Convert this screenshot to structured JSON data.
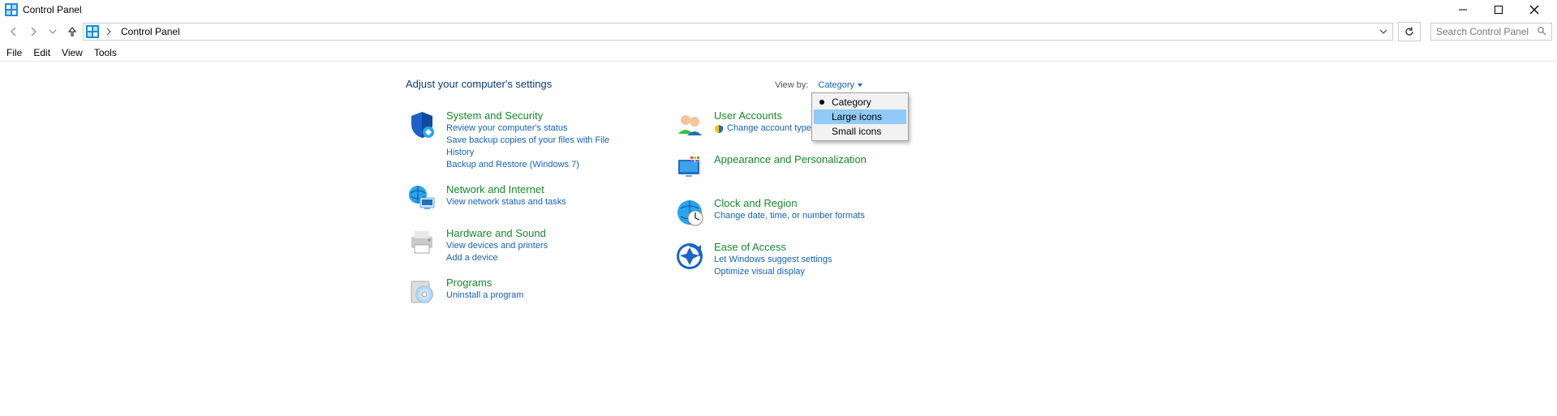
{
  "window": {
    "title": "Control Panel"
  },
  "address": {
    "crumb": "Control Panel"
  },
  "search": {
    "placeholder": "Search Control Panel"
  },
  "menu": [
    "File",
    "Edit",
    "View",
    "Tools"
  ],
  "header": {
    "heading": "Adjust your computer's settings",
    "viewby_label": "View by:",
    "viewby_value": "Category"
  },
  "viewby_options": [
    {
      "label": "Category",
      "selected": true,
      "hover": false
    },
    {
      "label": "Large icons",
      "selected": false,
      "hover": true
    },
    {
      "label": "Small icons",
      "selected": false,
      "hover": false
    }
  ],
  "left": [
    {
      "title": "System and Security",
      "links": [
        "Review your computer's status",
        "Save backup copies of your files with File History",
        "Backup and Restore (Windows 7)"
      ]
    },
    {
      "title": "Network and Internet",
      "links": [
        "View network status and tasks"
      ]
    },
    {
      "title": "Hardware and Sound",
      "links": [
        "View devices and printers",
        "Add a device"
      ]
    },
    {
      "title": "Programs",
      "links": [
        "Uninstall a program"
      ]
    }
  ],
  "right": [
    {
      "title": "User Accounts",
      "links": [
        "Change account type"
      ],
      "shield_on_link": true
    },
    {
      "title": "Appearance and Personalization",
      "links": []
    },
    {
      "title": "Clock and Region",
      "links": [
        "Change date, time, or number formats"
      ]
    },
    {
      "title": "Ease of Access",
      "links": [
        "Let Windows suggest settings",
        "Optimize visual display"
      ]
    }
  ]
}
